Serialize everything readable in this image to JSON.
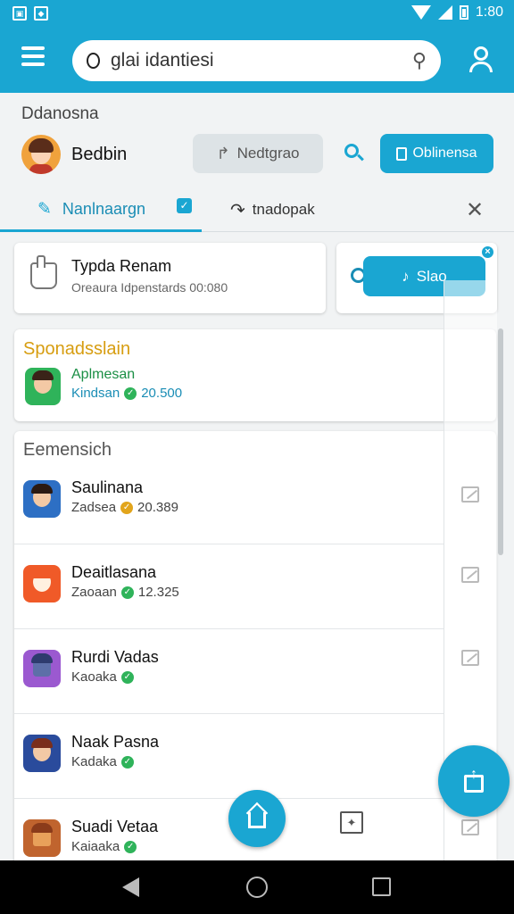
{
  "status_bar": {
    "time": "1:80",
    "icons": [
      "image-icon",
      "android-icon",
      "wifi-icon",
      "signal-icon",
      "battery-icon"
    ]
  },
  "app_bar": {
    "menu_icon": "menu-icon",
    "search": {
      "value": "",
      "placeholder": "glai idantiesi"
    },
    "profile_icon": "profile-icon",
    "color": "#1aa6d2"
  },
  "header": {
    "section_label": "Ddanosna",
    "user_name": "Bedbin",
    "grey_button": "Nedtgrao",
    "blue_button": "Oblinensa"
  },
  "tabs": {
    "tab1_label": "Nanlnaargn",
    "tab2_label": "tnadopak"
  },
  "card_a": {
    "title": "Typda Renam",
    "subtitle": "Oreaura Idpenstards 00:080"
  },
  "card_b": {
    "button_label": "Slao"
  },
  "sponsored": {
    "title": "Sponadsslain",
    "item": {
      "name": "Aplmesan",
      "meta": "Kindsan",
      "value": "20.500"
    }
  },
  "list": {
    "title": "Eemensich",
    "items": [
      {
        "name": "Saulinana",
        "meta": "Zadsea",
        "value": "20.389",
        "badge": "gold"
      },
      {
        "name": "Deaitlasana",
        "meta": "Zaoaan",
        "value": "12.325",
        "badge": "green"
      },
      {
        "name": "Rurdi Vadas",
        "meta": "Kaoaka",
        "value": "",
        "badge": "green"
      },
      {
        "name": "Naak Pasna",
        "meta": "Kadaka",
        "value": "",
        "badge": "green"
      },
      {
        "name": "Suadi Vetaa",
        "meta": "Kaiaaka",
        "value": "",
        "badge": "green"
      }
    ]
  },
  "colors": {
    "accent": "#1aa6d2",
    "sponsor_title": "#d79d10",
    "verified": "#2fb35a"
  }
}
